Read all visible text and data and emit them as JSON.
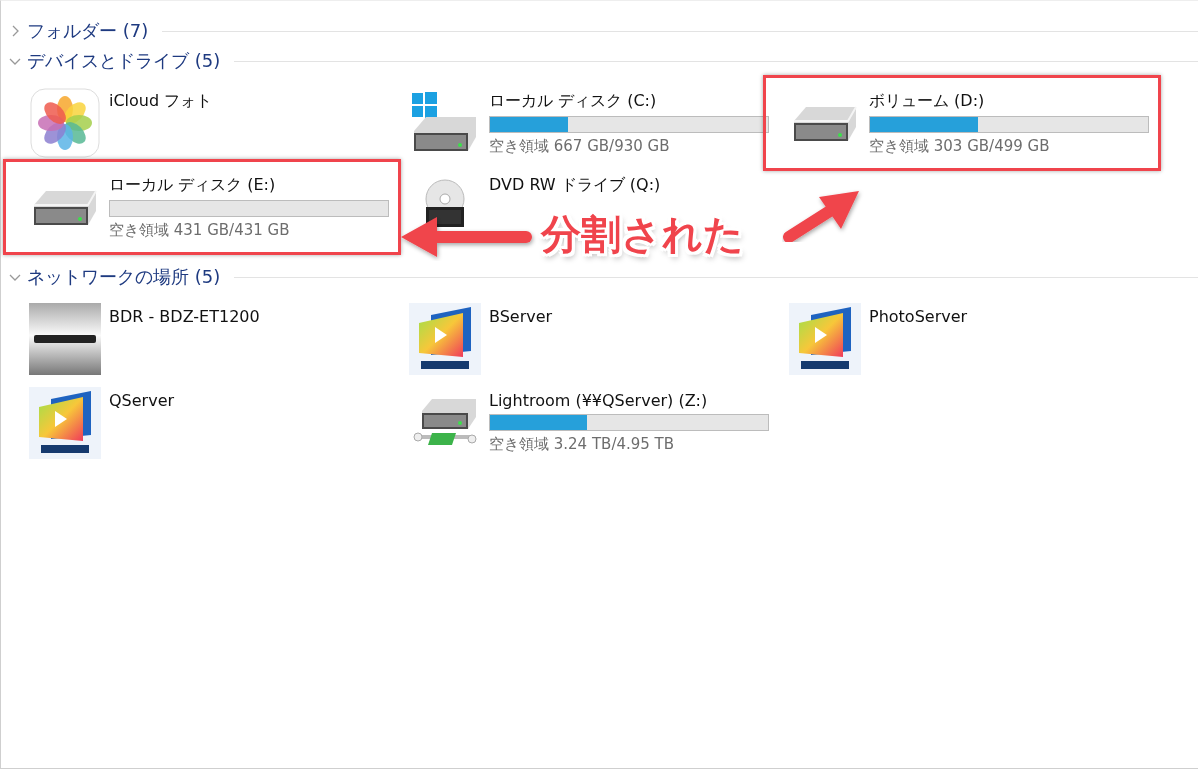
{
  "groups": [
    {
      "title": "フォルダー (7)",
      "expanded": false
    },
    {
      "title": "デバイスとドライブ (5)",
      "expanded": true,
      "items": [
        {
          "kind": "photos",
          "name": "iCloud フォト",
          "highlighted": false
        },
        {
          "kind": "systemdrive",
          "name": "ローカル ディスク (C:)",
          "level": 0.28,
          "free": "空き領域 667 GB/930 GB",
          "highlighted": false
        },
        {
          "kind": "drive",
          "name": "ボリューム (D:)",
          "level": 0.39,
          "free": "空き領域 303 GB/499 GB",
          "highlighted": true
        },
        {
          "kind": "drive",
          "name": "ローカル ディスク (E:)",
          "level": 0,
          "free": "空き領域 431 GB/431 GB",
          "highlighted": true
        },
        {
          "kind": "dvd",
          "name": "DVD RW ドライブ (Q:)",
          "highlighted": false
        }
      ]
    },
    {
      "title": "ネットワークの場所 (5)",
      "expanded": true,
      "items": [
        {
          "kind": "device",
          "name": "BDR - BDZ-ET1200",
          "highlighted": false
        },
        {
          "kind": "nas",
          "name": "BServer",
          "highlighted": false
        },
        {
          "kind": "nas",
          "name": "PhotoServer",
          "highlighted": false
        },
        {
          "kind": "nas",
          "name": "QServer",
          "highlighted": false
        },
        {
          "kind": "networkdrive",
          "name": "Lightroom (¥¥QServer) (Z:)",
          "level": 0.35,
          "free": "空き領域 3.24 TB/4.95 TB",
          "highlighted": false
        }
      ]
    }
  ],
  "annotation": {
    "text": "分割された"
  }
}
